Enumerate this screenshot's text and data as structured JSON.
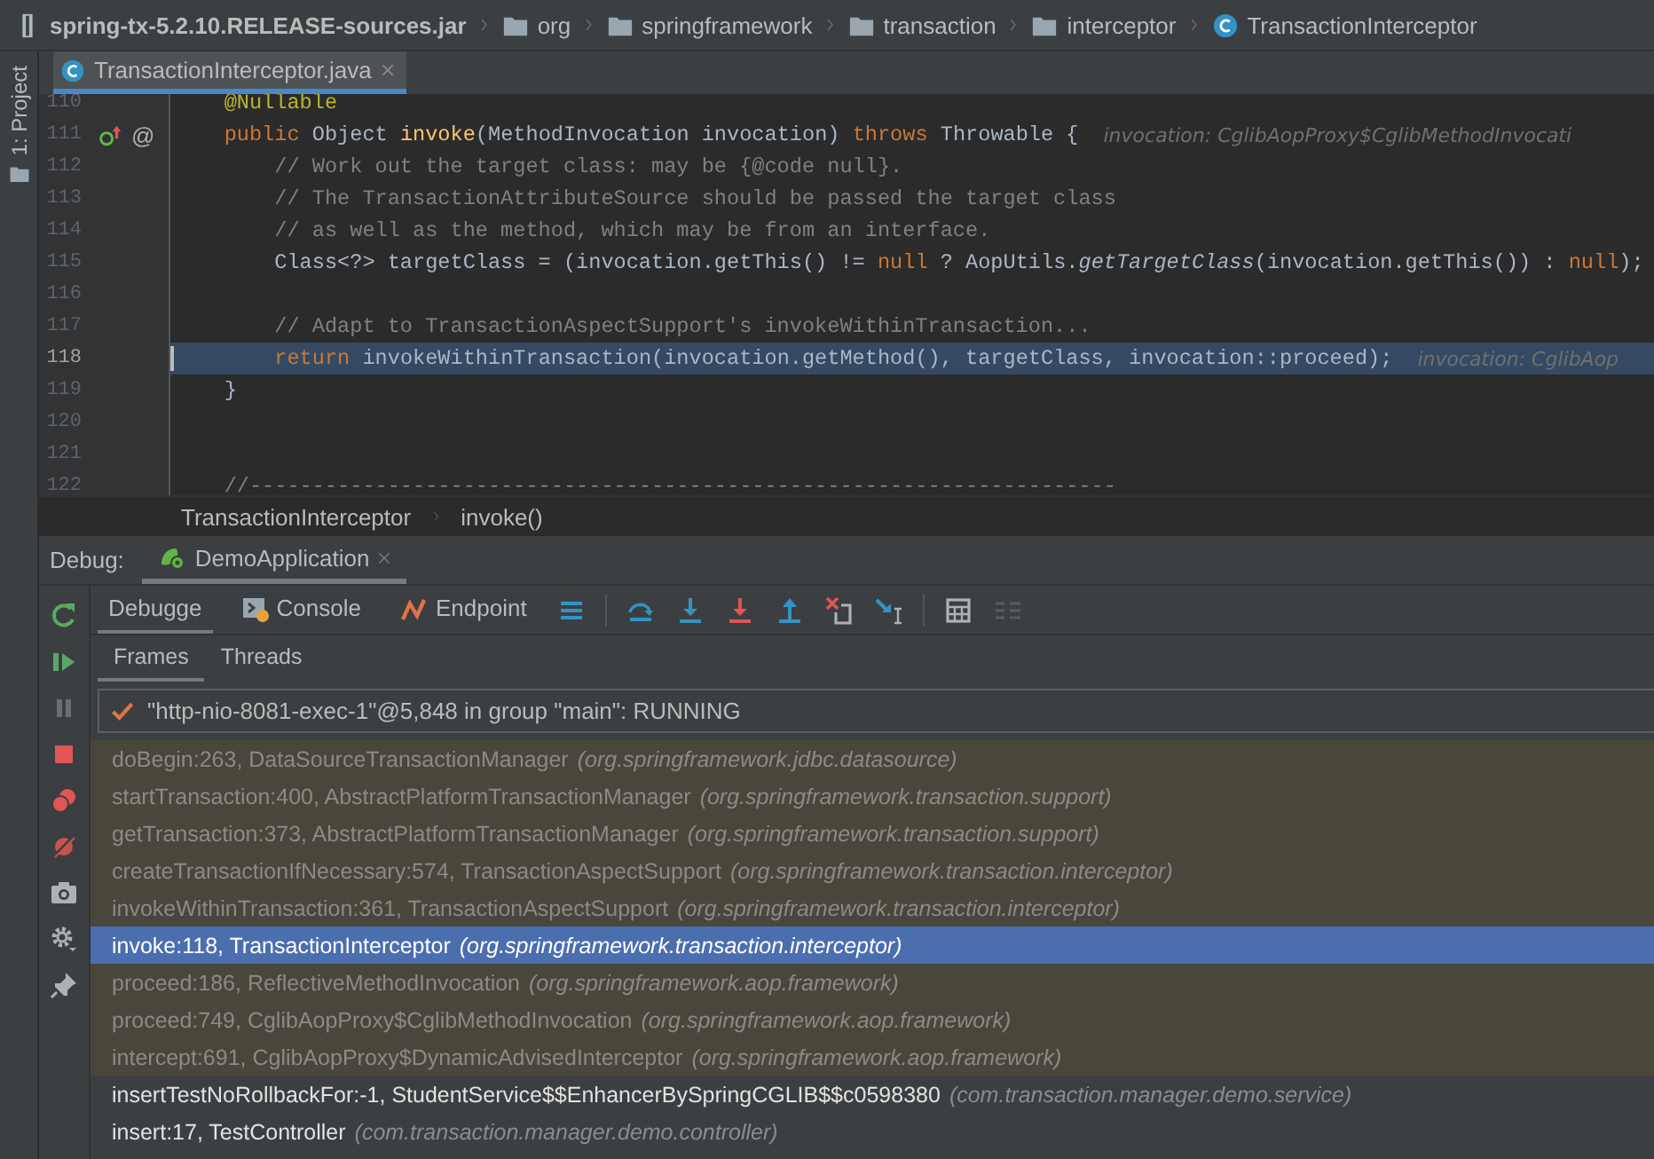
{
  "breadcrumbs": [
    {
      "label": "spring-tx-5.2.10.RELEASE-sources.jar",
      "kind": "jar"
    },
    {
      "label": "org",
      "kind": "folder"
    },
    {
      "label": "springframework",
      "kind": "folder"
    },
    {
      "label": "transaction",
      "kind": "folder"
    },
    {
      "label": "interceptor",
      "kind": "folder"
    },
    {
      "label": "TransactionInterceptor",
      "kind": "class"
    }
  ],
  "side_stripe": {
    "label": "1: Project"
  },
  "editor_tabs": [
    {
      "label": "TransactionInterceptor.java",
      "selected": true
    }
  ],
  "code_lines": [
    {
      "number": "110",
      "current": false,
      "tokens": [
        {
          "text": "    @Nullable",
          "kind": "annotation"
        }
      ]
    },
    {
      "number": "111",
      "current": false,
      "overrides": true,
      "gutter_text": "@",
      "tokens": [
        {
          "text": "    public",
          "kind": "keyword"
        },
        {
          "text": " Object ",
          "kind": "plain"
        },
        {
          "text": "invoke",
          "kind": "method"
        },
        {
          "text": "(MethodInvocation invocation) ",
          "kind": "plain"
        },
        {
          "text": "throws",
          "kind": "keyword"
        },
        {
          "text": " Throwable {",
          "kind": "plain"
        },
        {
          "text": "invocation: CglibAopProxy$CglibMethodInvocati",
          "kind": "inlay"
        }
      ]
    },
    {
      "number": "112",
      "current": false,
      "tokens": [
        {
          "text": "        // Work out the target class: may be {@code null}.",
          "kind": "comment"
        }
      ]
    },
    {
      "number": "113",
      "current": false,
      "tokens": [
        {
          "text": "        // The TransactionAttributeSource should be passed the target class",
          "kind": "comment"
        }
      ]
    },
    {
      "number": "114",
      "current": false,
      "tokens": [
        {
          "text": "        // as well as the method, which may be from an interface.",
          "kind": "comment"
        }
      ]
    },
    {
      "number": "115",
      "current": false,
      "tokens": [
        {
          "text": "        Class<?> targetClass = (invocation.getThis() != ",
          "kind": "plain"
        },
        {
          "text": "null",
          "kind": "keyword"
        },
        {
          "text": " ? AopUtils.",
          "kind": "plain"
        },
        {
          "text": "getTargetClass",
          "kind": "static"
        },
        {
          "text": "(invocation.getThis()) : ",
          "kind": "plain"
        },
        {
          "text": "null",
          "kind": "keyword"
        },
        {
          "text": ");",
          "kind": "plain"
        }
      ]
    },
    {
      "number": "116",
      "current": false
    },
    {
      "number": "117",
      "current": false,
      "tokens": [
        {
          "text": "        // Adapt to TransactionAspectSupport's invokeWithinTransaction...",
          "kind": "comment"
        }
      ]
    },
    {
      "number": "118",
      "current": true,
      "tokens": [
        {
          "text": "        return",
          "kind": "keyword"
        },
        {
          "text": " invokeWithinTransaction(invocation.getMethod(), targetClass, invocation::proceed);",
          "kind": "plain"
        },
        {
          "text": "invocation: CglibAop",
          "kind": "inlay"
        }
      ]
    },
    {
      "number": "119",
      "current": false,
      "tokens": [
        {
          "text": "    }",
          "kind": "plain"
        }
      ]
    },
    {
      "number": "120",
      "current": false
    },
    {
      "number": "121",
      "current": false
    },
    {
      "number": "122",
      "current": false,
      "tokens": [
        {
          "text": "    //---------------------------------------------------------------------",
          "kind": "comment"
        }
      ]
    }
  ],
  "editor_breadcrumb": [
    "TransactionInterceptor",
    "invoke()"
  ],
  "debug": {
    "title": "Debug:",
    "sessions": [
      {
        "label": "DemoApplication",
        "selected": true
      }
    ],
    "tabs": [
      {
        "label": "Debugge",
        "kind": "debugger",
        "selected": true
      },
      {
        "label": "Console",
        "kind": "console",
        "selected": false
      },
      {
        "label": "Endpoint",
        "kind": "endpoints",
        "selected": false
      }
    ],
    "subtabs": [
      {
        "label": "Frames",
        "selected": true
      },
      {
        "label": "Threads",
        "selected": false
      }
    ],
    "thread": "\"http-nio-8081-exec-1\"@5,848 in group \"main\": RUNNING",
    "frames": [
      {
        "method": "doBegin:263, DataSourceTransactionManager",
        "package": "(org.springframework.jdbc.datasource)",
        "kind": "library",
        "selected": false
      },
      {
        "method": "startTransaction:400, AbstractPlatformTransactionManager",
        "package": "(org.springframework.transaction.support)",
        "kind": "library",
        "selected": false
      },
      {
        "method": "getTransaction:373, AbstractPlatformTransactionManager",
        "package": "(org.springframework.transaction.support)",
        "kind": "library",
        "selected": false
      },
      {
        "method": "createTransactionIfNecessary:574, TransactionAspectSupport",
        "package": "(org.springframework.transaction.interceptor)",
        "kind": "library",
        "selected": false
      },
      {
        "method": "invokeWithinTransaction:361, TransactionAspectSupport",
        "package": "(org.springframework.transaction.interceptor)",
        "kind": "library",
        "selected": false
      },
      {
        "method": "invoke:118, TransactionInterceptor",
        "package": "(org.springframework.transaction.interceptor)",
        "kind": "library",
        "selected": true
      },
      {
        "method": "proceed:186, ReflectiveMethodInvocation",
        "package": "(org.springframework.aop.framework)",
        "kind": "library",
        "selected": false
      },
      {
        "method": "proceed:749, CglibAopProxy$CglibMethodInvocation",
        "package": "(org.springframework.aop.framework)",
        "kind": "library",
        "selected": false
      },
      {
        "method": "intercept:691, CglibAopProxy$DynamicAdvisedInterceptor",
        "package": "(org.springframework.aop.framework)",
        "kind": "library",
        "selected": false
      },
      {
        "method": "insertTestNoRollbackFor:-1, StudentService$$EnhancerBySpringCGLIB$$c0598380",
        "package": "(com.transaction.manager.demo.service)",
        "kind": "user",
        "selected": false
      },
      {
        "method": "insert:17, TestController",
        "package": "(com.transaction.manager.demo.controller)",
        "kind": "user",
        "selected": false
      }
    ]
  }
}
